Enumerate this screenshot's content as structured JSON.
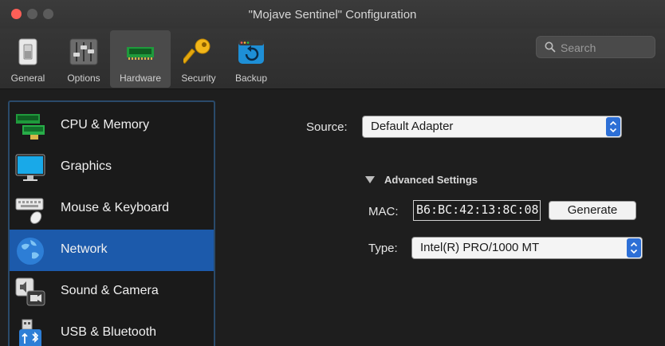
{
  "window": {
    "title": "\"Mojave Sentinel\" Configuration"
  },
  "toolbar": {
    "items": [
      {
        "label": "General",
        "icon": "switch-icon"
      },
      {
        "label": "Options",
        "icon": "sliders-icon"
      },
      {
        "label": "Hardware",
        "icon": "ram-chip-icon",
        "active": true
      },
      {
        "label": "Security",
        "icon": "key-icon"
      },
      {
        "label": "Backup",
        "icon": "backup-icon"
      }
    ],
    "search_placeholder": "Search"
  },
  "sidebar": {
    "items": [
      {
        "label": "CPU & Memory",
        "icon": "ram-chip-icon"
      },
      {
        "label": "Graphics",
        "icon": "monitor-icon"
      },
      {
        "label": "Mouse & Keyboard",
        "icon": "keyboard-mouse-icon"
      },
      {
        "label": "Network",
        "icon": "globe-icon",
        "selected": true
      },
      {
        "label": "Sound & Camera",
        "icon": "speaker-camera-icon"
      },
      {
        "label": "USB & Bluetooth",
        "icon": "usb-bluetooth-icon"
      }
    ]
  },
  "network": {
    "source_label": "Source:",
    "source_value": "Default Adapter",
    "advanced_label": "Advanced Settings",
    "mac_label": "MAC:",
    "mac_value": "B6:BC:42:13:8C:08",
    "generate_label": "Generate",
    "type_label": "Type:",
    "type_value": "Intel(R) PRO/1000 MT"
  },
  "colors": {
    "selection": "#1c5aab",
    "stepper": "#2d6fd6",
    "close": "#ff5f57"
  }
}
